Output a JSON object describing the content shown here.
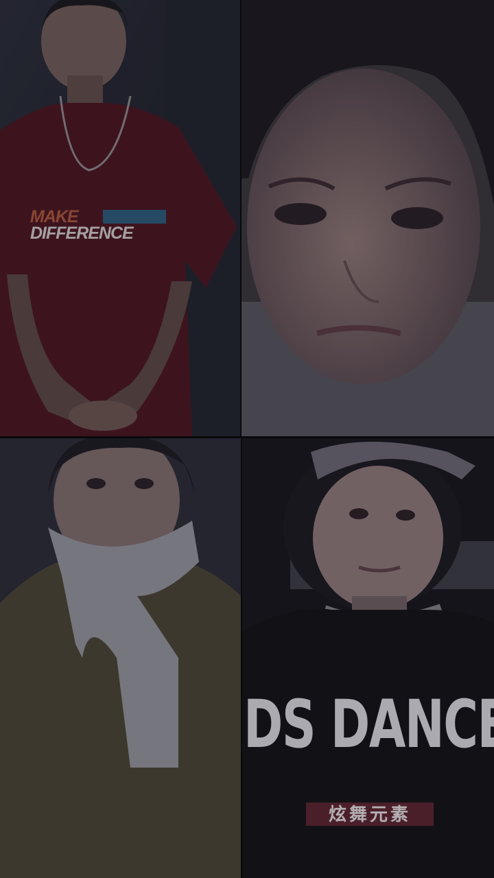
{
  "panels": [
    {
      "name": "boy-red-shirt",
      "shirt_text": [
        "MAKE",
        "DIFFERENCE"
      ]
    },
    {
      "name": "girl-closeup"
    },
    {
      "name": "boy-yellow-coat"
    },
    {
      "name": "boy-hat-black-shirt",
      "shirt_text": [
        "DS DANCE",
        "炫舞元素"
      ]
    }
  ],
  "colors": {
    "background": "#0a0a0d",
    "red_shirt": "#4a1822",
    "yellow_coat": "#4a4434",
    "black_shirt": "#151518"
  }
}
